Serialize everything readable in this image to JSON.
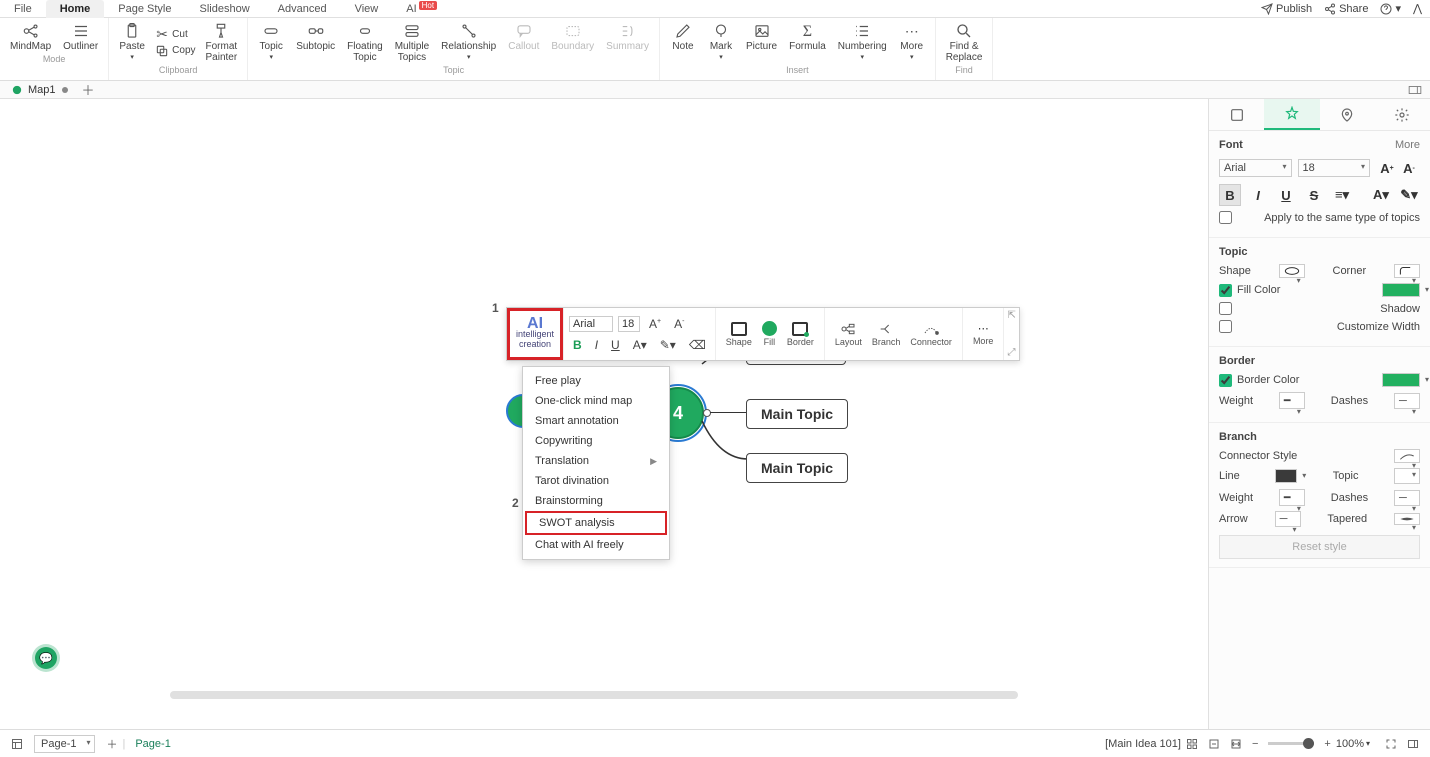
{
  "menu": {
    "tabs": [
      "File",
      "Home",
      "Page Style",
      "Slideshow",
      "Advanced",
      "View",
      "AI"
    ],
    "active": "Home",
    "ai_badge": "Hot",
    "publish": "Publish",
    "share": "Share"
  },
  "ribbon": {
    "mode": {
      "mindmap": "MindMap",
      "outliner": "Outliner",
      "label": "Mode"
    },
    "clipboard": {
      "paste": "Paste",
      "cut": "Cut",
      "copy": "Copy",
      "format_painter": "Format\nPainter",
      "label": "Clipboard"
    },
    "topic": {
      "topic": "Topic",
      "subtopic": "Subtopic",
      "floating": "Floating\nTopic",
      "multiple": "Multiple\nTopics",
      "relationship": "Relationship",
      "callout": "Callout",
      "boundary": "Boundary",
      "summary": "Summary",
      "label": "Topic"
    },
    "insert": {
      "note": "Note",
      "mark": "Mark",
      "picture": "Picture",
      "formula": "Formula",
      "numbering": "Numbering",
      "more": "More",
      "label": "Insert"
    },
    "find": {
      "find_replace": "Find &\nReplace",
      "label": "Find"
    }
  },
  "doctab": {
    "name": "Map1"
  },
  "canvas": {
    "annot1": "1",
    "annot2": "2",
    "center": "4",
    "main_topic": "Main Topic"
  },
  "float_tb": {
    "ai": "AI",
    "ai_sub": "intelligent\ncreation",
    "font": "Arial",
    "size": "18",
    "shape": "Shape",
    "fill": "Fill",
    "border": "Border",
    "layout": "Layout",
    "branch": "Branch",
    "connector": "Connector",
    "more": "More"
  },
  "ai_menu": {
    "items": [
      "Free play",
      "One-click mind map",
      "Smart annotation",
      "Copywriting",
      "Translation",
      "Tarot divination",
      "Brainstorming",
      "SWOT analysis",
      "Chat with AI freely"
    ],
    "highlighted": "SWOT analysis",
    "submenu_on": "Translation"
  },
  "panel": {
    "font": {
      "title": "Font",
      "more": "More",
      "family": "Arial",
      "size": "18",
      "apply_same": "Apply to the same type of topics"
    },
    "topic": {
      "title": "Topic",
      "shape": "Shape",
      "corner": "Corner",
      "fill_color": "Fill Color",
      "shadow": "Shadow",
      "custom_width": "Customize Width"
    },
    "border": {
      "title": "Border",
      "border_color": "Border Color",
      "weight": "Weight",
      "dashes": "Dashes"
    },
    "branch": {
      "title": "Branch",
      "connector_style": "Connector Style",
      "line": "Line",
      "topic": "Topic",
      "weight": "Weight",
      "dashes": "Dashes",
      "arrow": "Arrow",
      "tapered": "Tapered",
      "reset": "Reset style"
    }
  },
  "status": {
    "page_sel": "Page-1",
    "page_tab": "Page-1",
    "selection": "[Main Idea 101]",
    "zoom": "100%"
  },
  "colors": {
    "accent": "#20a95f",
    "highlight": "#d72227"
  }
}
